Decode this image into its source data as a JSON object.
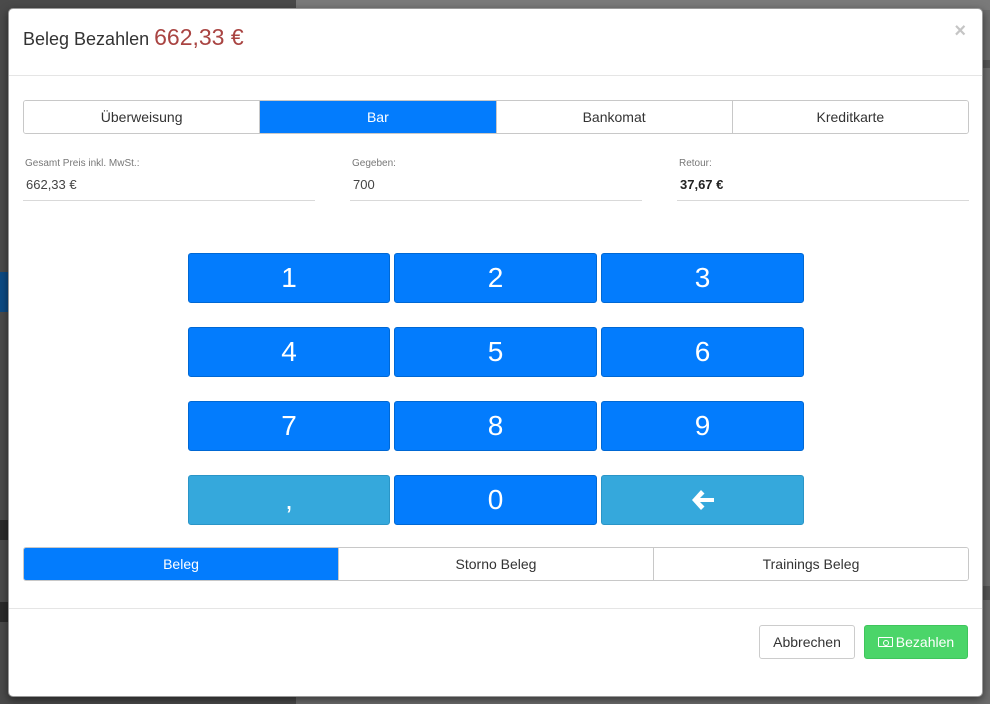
{
  "modal": {
    "title": "Beleg Bezahlen",
    "amount": "662,33 €",
    "close": "×"
  },
  "payment_methods": [
    {
      "label": "Überweisung",
      "active": false
    },
    {
      "label": "Bar",
      "active": true
    },
    {
      "label": "Bankomat",
      "active": false
    },
    {
      "label": "Kreditkarte",
      "active": false
    }
  ],
  "fields": {
    "total": {
      "label": "Gesamt Preis inkl. MwSt.:",
      "value": "662,33 €"
    },
    "given": {
      "label": "Gegeben:",
      "value": "700"
    },
    "change": {
      "label": "Retour:",
      "value": "37,67 €"
    }
  },
  "keypad": {
    "k1": "1",
    "k2": "2",
    "k3": "3",
    "k4": "4",
    "k5": "5",
    "k6": "6",
    "k7": "7",
    "k8": "8",
    "k9": "9",
    "comma": ",",
    "k0": "0",
    "backspace_icon": "arrow-left-icon"
  },
  "receipt_types": [
    {
      "label": "Beleg",
      "active": true
    },
    {
      "label": "Storno Beleg",
      "active": false
    },
    {
      "label": "Trainings Beleg",
      "active": false
    }
  ],
  "footer": {
    "cancel": "Abbrechen",
    "pay": "Bezahlen",
    "pay_icon": "money-icon"
  },
  "colors": {
    "primary": "#037cfd",
    "secondary_key": "#35a8dc",
    "success": "#4bd569",
    "amount": "#a94442"
  }
}
